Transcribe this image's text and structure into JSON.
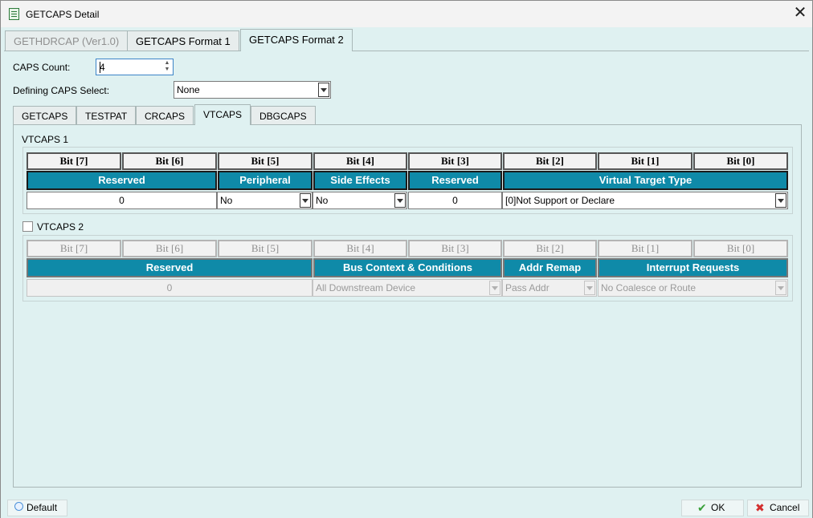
{
  "window": {
    "title": "GETCAPS Detail",
    "close_glyph": "✕"
  },
  "format_tabs": [
    {
      "label": "GETHDRCAP (Ver1.0)"
    },
    {
      "label": "GETCAPS Format 1"
    },
    {
      "label": "GETCAPS Format 2"
    }
  ],
  "caps_count": {
    "label": "CAPS Count:",
    "value": "4"
  },
  "defining_caps": {
    "label": "Defining CAPS Select:",
    "value": "None"
  },
  "sub_tabs": [
    {
      "label": "GETCAPS"
    },
    {
      "label": "TESTPAT"
    },
    {
      "label": "CRCAPS"
    },
    {
      "label": "VTCAPS"
    },
    {
      "label": "DBGCAPS"
    }
  ],
  "vtcaps1": {
    "title": "VTCAPS 1",
    "bits": [
      "Bit [7]",
      "Bit [6]",
      "Bit [5]",
      "Bit [4]",
      "Bit [3]",
      "Bit [2]",
      "Bit [1]",
      "Bit [0]"
    ],
    "headers": [
      "Reserved",
      "Peripheral",
      "Side Effects",
      "Reserved",
      "Virtual Target Type"
    ],
    "values": [
      "0",
      "No",
      "No",
      "0",
      "[0]Not Support or Declare"
    ]
  },
  "vtcaps2": {
    "title": "VTCAPS 2",
    "checked": false,
    "bits": [
      "Bit [7]",
      "Bit [6]",
      "Bit [5]",
      "Bit [4]",
      "Bit [3]",
      "Bit [2]",
      "Bit [1]",
      "Bit [0]"
    ],
    "headers": [
      "Reserved",
      "Bus Context & Conditions",
      "Addr Remap",
      "Interrupt Requests"
    ],
    "values": [
      "0",
      "All Downstream Device",
      "Pass Addr",
      "No Coalesce or Route"
    ]
  },
  "bottom": {
    "default_label": "Default",
    "ok_label": "OK",
    "cancel_label": "Cancel"
  },
  "colors": {
    "header_bg": "#0f8aa8",
    "panel_bg": "#dff1f1"
  }
}
